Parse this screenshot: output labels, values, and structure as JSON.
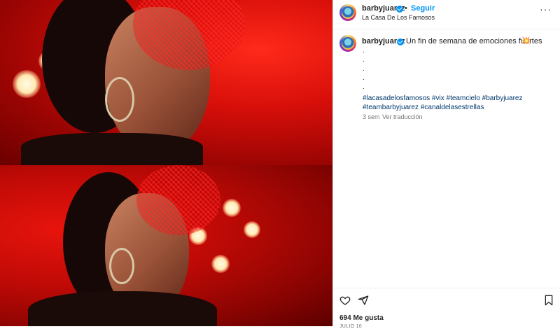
{
  "post": {
    "username": "barbyjuarez",
    "follow_label": "Seguir",
    "separator": "•",
    "location": "La Casa De Los Famosos",
    "more_label": "···"
  },
  "caption": {
    "username": "barbyjuarez",
    "text": "Un fin de semana de emociones fuertes",
    "emoji": "💥",
    "dots": [
      ".",
      ".",
      ".",
      ".",
      "."
    ],
    "hashtags_line1": [
      "#lacasadelosfamosos",
      "#vix",
      "#teamcielo",
      "#barbyjuarez"
    ],
    "hashtags_line2": [
      "#teambarbyjuarez",
      "#canaldelasestrellas"
    ],
    "age": "3 sem",
    "translate_label": "Ver traducción"
  },
  "footer": {
    "likes": "694 Me gusta",
    "date": "JULIO 10"
  },
  "colors": {
    "link": "#00376b",
    "accent": "#0095f6",
    "muted": "#737373"
  },
  "icons": {
    "like": "heart-outline",
    "share": "paper-plane",
    "save": "bookmark",
    "verified": "verified-badge"
  }
}
